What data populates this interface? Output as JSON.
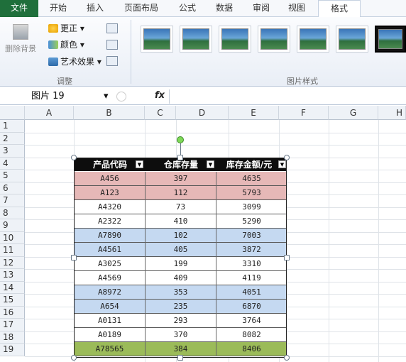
{
  "ribbon_tabs": [
    "文件",
    "开始",
    "插入",
    "页面布局",
    "公式",
    "数据",
    "审阅",
    "视图",
    "格式"
  ],
  "adjust_group": {
    "remove_bg": "删除背景",
    "corrections": "更正",
    "color": "颜色",
    "artistic": "艺术效果",
    "label": "调整"
  },
  "styles_group": {
    "label": "图片样式"
  },
  "name_box": "图片 19",
  "fx_label": "fx",
  "columns": [
    "A",
    "B",
    "C",
    "D",
    "E",
    "F",
    "G",
    "H"
  ],
  "rows": [
    "1",
    "2",
    "3",
    "4",
    "5",
    "6",
    "7",
    "8",
    "9",
    "10",
    "11",
    "12",
    "13",
    "14",
    "15",
    "16",
    "17",
    "18",
    "19"
  ],
  "table": {
    "headers": [
      "产品代码",
      "仓库存量",
      "库存金额/元"
    ],
    "rows": [
      {
        "code": "A456",
        "qty": "397",
        "amount": "4635",
        "color": "#e6b8b7"
      },
      {
        "code": "A123",
        "qty": "112",
        "amount": "5793",
        "color": "#e6b8b7"
      },
      {
        "code": "A4320",
        "qty": "73",
        "amount": "3099",
        "color": "#ffffff"
      },
      {
        "code": "A2322",
        "qty": "410",
        "amount": "5290",
        "color": "#ffffff"
      },
      {
        "code": "A7890",
        "qty": "102",
        "amount": "7003",
        "color": "#c5d9f1"
      },
      {
        "code": "A4561",
        "qty": "405",
        "amount": "3872",
        "color": "#c5d9f1"
      },
      {
        "code": "A3025",
        "qty": "199",
        "amount": "3310",
        "color": "#ffffff"
      },
      {
        "code": "A4569",
        "qty": "409",
        "amount": "4119",
        "color": "#ffffff"
      },
      {
        "code": "A8972",
        "qty": "353",
        "amount": "4051",
        "color": "#c5d9f1"
      },
      {
        "code": "A654",
        "qty": "235",
        "amount": "6870",
        "color": "#c5d9f1"
      },
      {
        "code": "A0131",
        "qty": "293",
        "amount": "3764",
        "color": "#ffffff"
      },
      {
        "code": "A0189",
        "qty": "370",
        "amount": "8082",
        "color": "#ffffff"
      },
      {
        "code": "A78565",
        "qty": "384",
        "amount": "8406",
        "color": "#9bbb59"
      }
    ]
  },
  "colors": {
    "file_tab": "#1f6f3b",
    "header_bg": "#0d0d0d",
    "selection_handle": "#7ed957"
  }
}
